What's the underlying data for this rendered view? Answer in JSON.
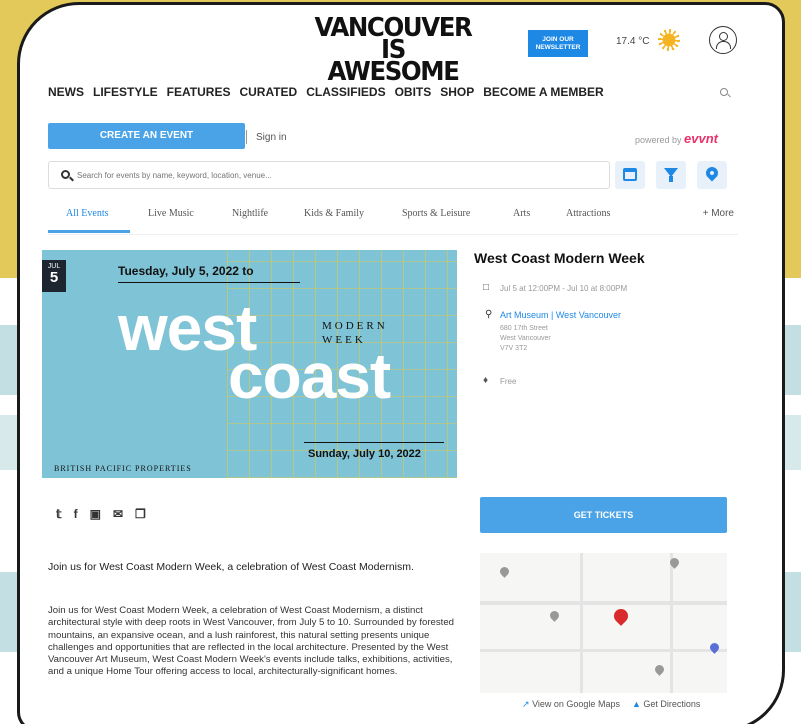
{
  "site": {
    "logo_line1": "VANCOUVER",
    "logo_line2": "IS AWESOME",
    "newsletter_label_1": "JOIN OUR",
    "newsletter_label_2": "NEWSLETTER",
    "temperature": "17.4 °C",
    "nav": [
      "NEWS",
      "LIFESTYLE",
      "FEATURES",
      "CURATED",
      "CLASSIFIEDS",
      "OBITS",
      "SHOP",
      "BECOME A MEMBER"
    ]
  },
  "evvnt": {
    "create_label": "CREATE AN EVENT",
    "signin_label": "Sign in",
    "powered_label": "powered by",
    "powered_brand": "evvnt",
    "search_placeholder": "Search for events by name, keyword, location, venue...",
    "categories": [
      "All Events",
      "Live Music",
      "Nightlife",
      "Kids & Family",
      "Sports & Leisure",
      "Arts",
      "Attractions"
    ],
    "more_label": "+ More"
  },
  "event": {
    "image": {
      "month": "JUL",
      "day": "5",
      "start_text": "Tuesday, July 5, 2022 to",
      "word1": "west",
      "modern_1": "MODERN",
      "modern_2": "WEEK",
      "word2": "coast",
      "end_text": "Sunday, July 10, 2022",
      "sponsor": "BRITISH PACIFIC PROPERTIES"
    },
    "title": "West Coast Modern Week",
    "datetime": "Jul 5 at 12:00PM - Jul 10 at 8:00PM",
    "venue": "Art Museum | West Vancouver",
    "address_1": "680 17th Street",
    "address_2": "West Vancouver",
    "address_3": "V7V 3T2",
    "price": "Free",
    "tickets_label": "GET TICKETS",
    "map_links": {
      "google": "View on Google Maps",
      "directions": "Get Directions"
    },
    "lead": "Join us for West Coast Modern Week, a celebration of West Coast Modernism.",
    "body": "Join us for West Coast Modern Week, a celebration of West Coast Modernism, a distinct architectural style with deep roots in West Vancouver, from July 5 to 10. Surrounded by forested mountains, an expansive ocean, and a lush rainforest, this natural setting presents unique challenges and opportunities that are reflected in the local architecture.  Presented by the West Vancouver Art Museum, West Coast Modern Week's events include talks, exhibitions, activities, and a unique Home Tour offering access to local, architecturally-significant homes."
  },
  "colors": {
    "accent": "#4aa3e6",
    "brand_blue": "#1e88e5",
    "evvnt_pink": "#e8336b",
    "background_yellow": "#e2c95a"
  }
}
